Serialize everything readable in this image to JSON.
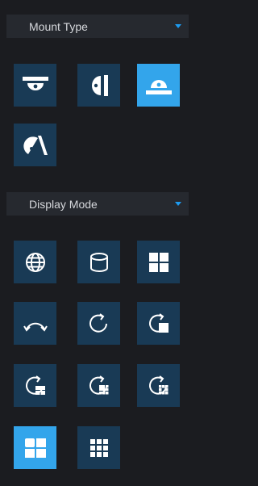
{
  "mount_type": {
    "label": "Mount Type",
    "options": [
      {
        "icon": "ceiling-mount-icon",
        "selected": false
      },
      {
        "icon": "wall-mount-icon",
        "selected": false
      },
      {
        "icon": "desktop-mount-icon",
        "selected": true
      },
      {
        "icon": "tilted-mount-icon",
        "selected": false
      }
    ]
  },
  "display_mode": {
    "label": "Display Mode",
    "options": [
      {
        "icon": "globe-icon",
        "selected": false
      },
      {
        "icon": "cylinder-icon",
        "selected": false
      },
      {
        "icon": "quad-split-icon",
        "selected": false
      },
      {
        "icon": "panorama-arc-icon",
        "selected": false
      },
      {
        "icon": "rotate-icon",
        "selected": false
      },
      {
        "icon": "rotate-with-single-view-icon",
        "selected": false
      },
      {
        "icon": "rotate-with-3-view-icon",
        "selected": false
      },
      {
        "icon": "rotate-with-6-view-icon",
        "selected": false
      },
      {
        "icon": "rotate-with-8-view-icon",
        "selected": false
      },
      {
        "icon": "four-view-icon",
        "selected": true
      },
      {
        "icon": "nine-view-icon",
        "selected": false
      }
    ]
  },
  "colors": {
    "background": "#1b1c20",
    "header": "#26292f",
    "button": "#193a55",
    "button_active": "#33a5eb",
    "accent": "#1d9bf0"
  }
}
